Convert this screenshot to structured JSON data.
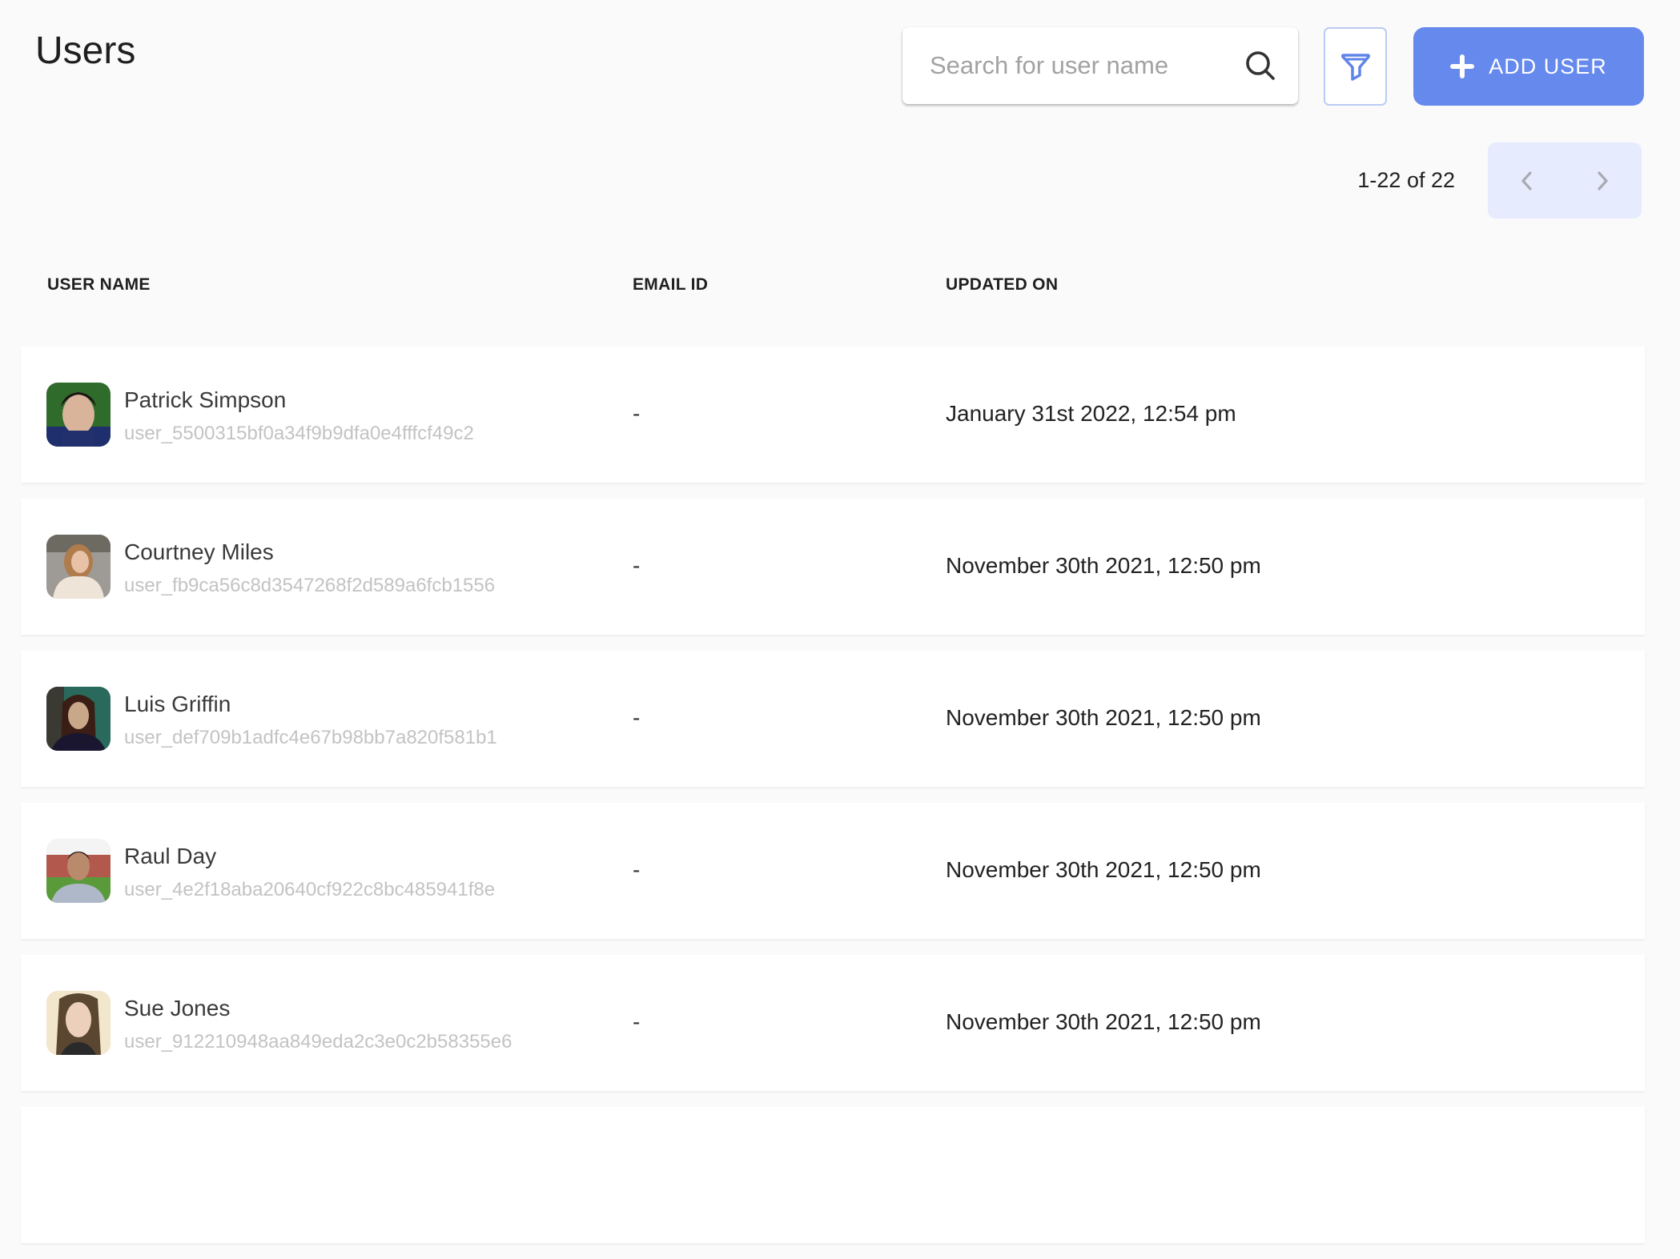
{
  "page": {
    "title": "Users"
  },
  "search": {
    "placeholder": "Search for user name",
    "value": ""
  },
  "toolbar": {
    "filter_label": "Filter",
    "add_user_label": "ADD USER"
  },
  "pagination": {
    "range_text": "1-22 of 22"
  },
  "colors": {
    "accent": "#6589ec",
    "pagination_bg": "#e6ebfd",
    "filter_border": "#bccbf5",
    "id_text": "#c3c3c3"
  },
  "table": {
    "headers": {
      "user_name": "USER NAME",
      "email_id": "EMAIL ID",
      "updated_on": "UPDATED ON"
    },
    "rows": [
      {
        "name": "Patrick Simpson",
        "user_id": "user_5500315bf0a34f9b9dfa0e4fffcf49c2",
        "email": "-",
        "updated_on": "January 31st 2022, 12:54 pm"
      },
      {
        "name": "Courtney Miles",
        "user_id": "user_fb9ca56c8d3547268f2d589a6fcb1556",
        "email": "-",
        "updated_on": "November 30th 2021, 12:50 pm"
      },
      {
        "name": "Luis Griffin",
        "user_id": "user_def709b1adfc4e67b98bb7a820f581b1",
        "email": "-",
        "updated_on": "November 30th 2021, 12:50 pm"
      },
      {
        "name": "Raul Day",
        "user_id": "user_4e2f18aba20640cf922c8bc485941f8e",
        "email": "-",
        "updated_on": "November 30th 2021, 12:50 pm"
      },
      {
        "name": "Sue Jones",
        "user_id": "user_912210948aa849eda2c3e0c2b58355e6",
        "email": "-",
        "updated_on": "November 30th 2021, 12:50 pm"
      }
    ]
  }
}
